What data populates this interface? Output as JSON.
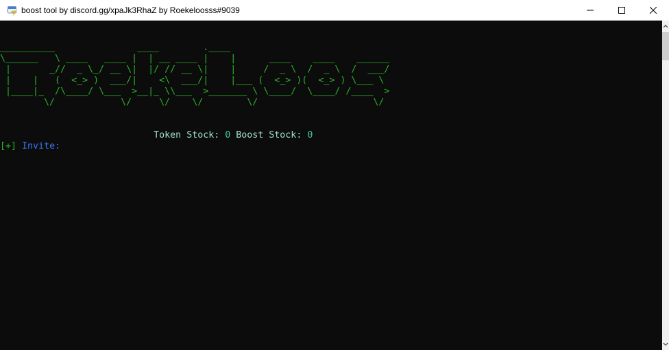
{
  "window": {
    "title": "boost tool by discord.gg/xpaJk3RhaZ by Roekeloosss#9039",
    "icons": {
      "app": "console-app-icon",
      "minimize": "minimize-icon",
      "maximize": "maximize-icon",
      "close": "close-icon",
      "scroll_up": "chevron-up-icon",
      "scroll_down": "chevron-down-icon"
    }
  },
  "colors": {
    "titlebar_bg": "#ffffff",
    "title_text": "#000000",
    "console_bg": "#0c0c0c",
    "green": "#2bb22b",
    "blue": "#3a76f0",
    "stock_label": "#9fe0ca",
    "stock_value": "#4cc796",
    "scroll_track": "#f0f0f0",
    "scroll_thumb": "#cdcdcd"
  },
  "console": {
    "lines": [
      {
        "name": "blank-line",
        "segments": []
      },
      {
        "name": "blank-line",
        "segments": []
      },
      {
        "name": "ascii-art-line",
        "segments": [
          {
            "text": "__________               ____        .____",
            "color": "green"
          }
        ]
      },
      {
        "name": "ascii-art-line",
        "segments": [
          {
            "text": "\\______   \\ ____   ____ |  | __ ____ |    |      ____    ____    ______",
            "color": "green"
          }
        ]
      },
      {
        "name": "ascii-art-line",
        "segments": [
          {
            "text": " |       _//  _ \\_/ __ \\|  |/ // __ \\|    |     /  _ \\  /  _ \\  /  ___/",
            "color": "green"
          }
        ]
      },
      {
        "name": "ascii-art-line",
        "segments": [
          {
            "text": " |    |   (  <_> )  ___/|    <\\  ___/|    |___ (  <_> )(  <_> ) \\___ \\ ",
            "color": "green"
          }
        ]
      },
      {
        "name": "ascii-art-line",
        "segments": [
          {
            "text": " |____|_  /\\____/ \\___  >__|_ \\\\___  >_______ \\ \\____/  \\____/ /____  >",
            "color": "green"
          }
        ]
      },
      {
        "name": "ascii-art-line",
        "segments": [
          {
            "text": "        \\/            \\/     \\/    \\/        \\/                     \\/",
            "color": "green"
          }
        ]
      },
      {
        "name": "blank-line",
        "segments": []
      },
      {
        "name": "blank-line",
        "segments": []
      },
      {
        "name": "stock-line",
        "segments": [
          {
            "text": "                            ",
            "color": "stock_label"
          },
          {
            "text": "Token Stock: ",
            "color": "stock_label",
            "name": "token-stock-label"
          },
          {
            "text": "0",
            "color": "stock_value",
            "name": "token-stock-value"
          },
          {
            "text": " Boost Stock: ",
            "color": "stock_label",
            "name": "boost-stock-label"
          },
          {
            "text": "0",
            "color": "stock_value",
            "name": "boost-stock-value"
          }
        ]
      },
      {
        "name": "invite-prompt-line",
        "segments": [
          {
            "text": "[+]",
            "color": "green",
            "name": "plus-badge"
          },
          {
            "text": " ",
            "color": "green"
          },
          {
            "text": "Invite:",
            "color": "blue",
            "name": "invite-label"
          }
        ]
      }
    ]
  }
}
